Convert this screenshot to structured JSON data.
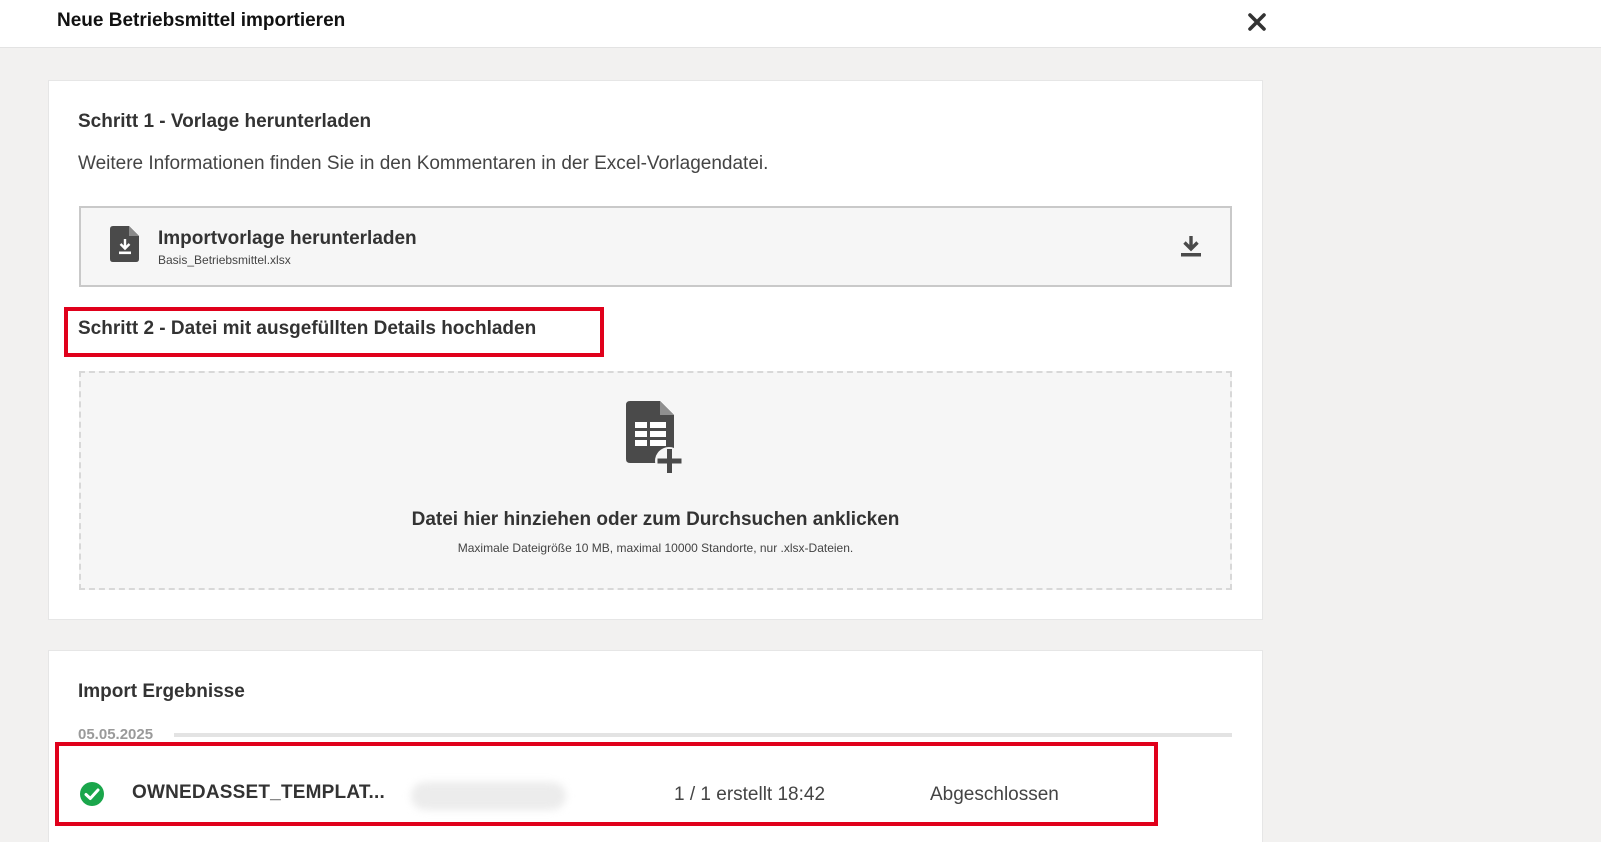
{
  "dialog": {
    "title": "Neue Betriebsmittel importieren",
    "close_icon": "close-icon"
  },
  "step1": {
    "heading": "Schritt 1 - Vorlage herunterladen",
    "info": "Weitere Informationen finden Sie in den Kommentaren in der Excel-Vorlagendatei.",
    "download": {
      "title": "Importvorlage herunterladen",
      "filename": "Basis_Betriebsmittel.xlsx",
      "file_icon": "file-download-icon",
      "action_icon": "download-icon"
    }
  },
  "step2": {
    "heading": "Schritt 2 - Datei mit ausgefüllten Details hochladen",
    "dropzone": {
      "icon": "spreadsheet-add-icon",
      "main": "Datei hier hinziehen oder zum Durchsuchen anklicken",
      "sub": "Maximale Dateigröße 10 MB, maximal 10000 Standorte, nur .xlsx-Dateien."
    }
  },
  "results": {
    "heading": "Import Ergebnisse",
    "groups": [
      {
        "date": "05.05.2025",
        "rows": [
          {
            "status_icon": "success-check-icon",
            "filename": "OWNEDASSET_TEMPLAT...",
            "count": "1 / 1 erstellt 18:42",
            "status": "Abgeschlossen"
          }
        ]
      }
    ]
  },
  "colors": {
    "highlight": "#e0001b",
    "success": "#1aa64b",
    "icon": "#4a4a4a"
  }
}
